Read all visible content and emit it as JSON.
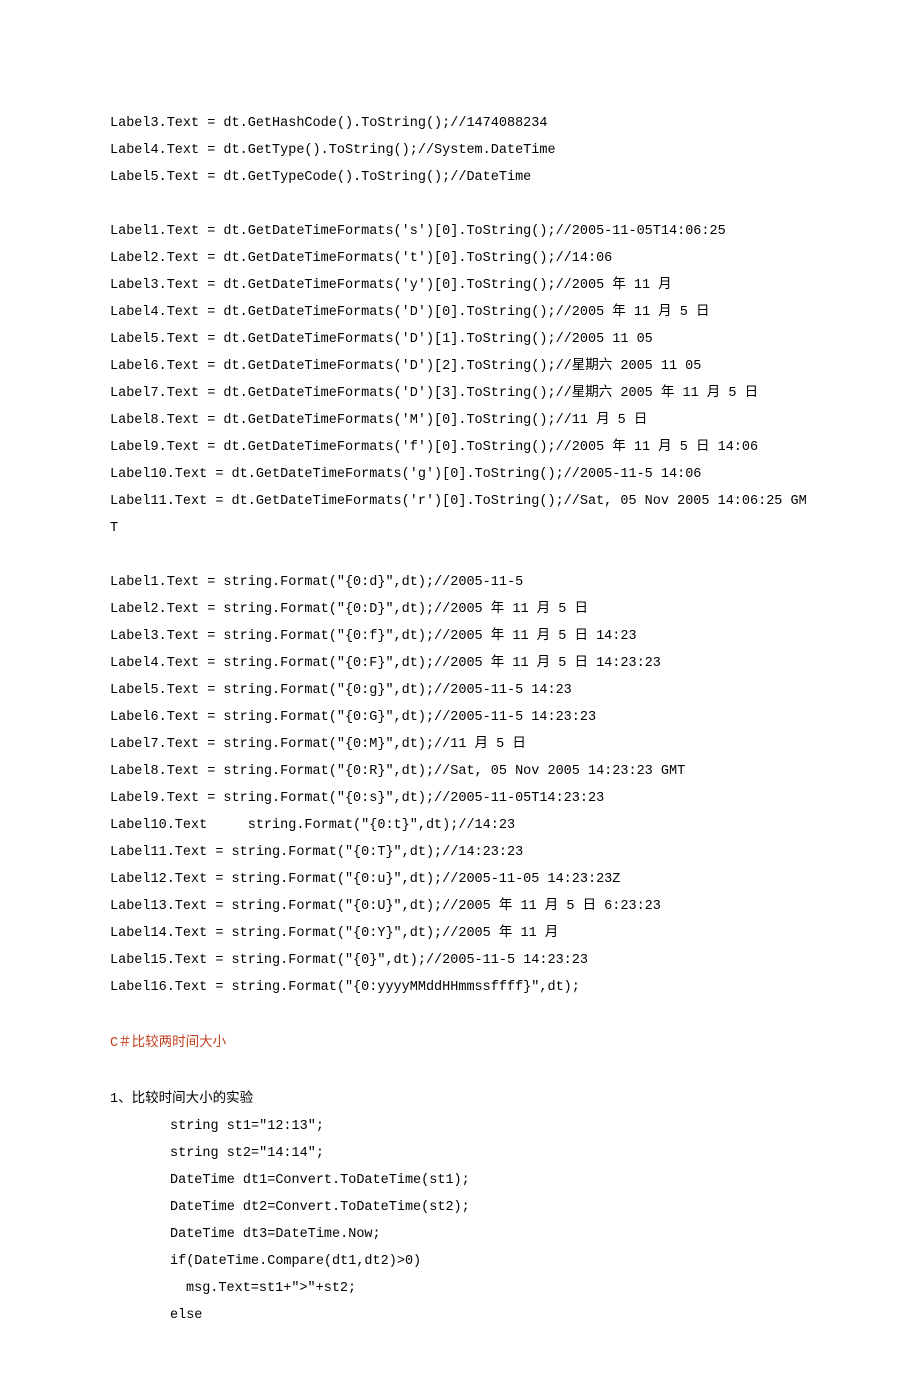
{
  "block1": [
    "Label3.Text = dt.GetHashCode().ToString();//1474088234",
    "Label4.Text = dt.GetType().ToString();//System.DateTime",
    "Label5.Text = dt.GetTypeCode().ToString();//DateTime"
  ],
  "block2": [
    "Label1.Text = dt.GetDateTimeFormats('s')[0].ToString();//2005-11-05T14:06:25",
    "Label2.Text = dt.GetDateTimeFormats('t')[0].ToString();//14:06",
    "Label3.Text = dt.GetDateTimeFormats('y')[0].ToString();//2005 年 11 月",
    "Label4.Text = dt.GetDateTimeFormats('D')[0].ToString();//2005 年 11 月 5 日",
    "Label5.Text = dt.GetDateTimeFormats('D')[1].ToString();//2005 11 05",
    "Label6.Text = dt.GetDateTimeFormats('D')[2].ToString();//星期六 2005 11 05",
    "Label7.Text = dt.GetDateTimeFormats('D')[3].ToString();//星期六 2005 年 11 月 5 日",
    "Label8.Text = dt.GetDateTimeFormats('M')[0].ToString();//11 月 5 日",
    "Label9.Text = dt.GetDateTimeFormats('f')[0].ToString();//2005 年 11 月 5 日 14:06",
    "Label10.Text = dt.GetDateTimeFormats('g')[0].ToString();//2005-11-5 14:06",
    "Label11.Text = dt.GetDateTimeFormats('r')[0].ToString();//Sat, 05 Nov 2005 14:06:25 GMT"
  ],
  "block3": [
    "Label1.Text = string.Format(\"{0:d}\",dt);//2005-11-5",
    "Label2.Text = string.Format(\"{0:D}\",dt);//2005 年 11 月 5 日",
    "Label3.Text = string.Format(\"{0:f}\",dt);//2005 年 11 月 5 日 14:23",
    "Label4.Text = string.Format(\"{0:F}\",dt);//2005 年 11 月 5 日 14:23:23",
    "Label5.Text = string.Format(\"{0:g}\",dt);//2005-11-5 14:23",
    "Label6.Text = string.Format(\"{0:G}\",dt);//2005-11-5 14:23:23",
    "Label7.Text = string.Format(\"{0:M}\",dt);//11 月 5 日",
    "Label8.Text = string.Format(\"{0:R}\",dt);//Sat, 05 Nov 2005 14:23:23 GMT",
    "Label9.Text = string.Format(\"{0:s}\",dt);//2005-11-05T14:23:23",
    "Label10.Text     string.Format(\"{0:t}\",dt);//14:23",
    "Label11.Text = string.Format(\"{0:T}\",dt);//14:23:23",
    "Label12.Text = string.Format(\"{0:u}\",dt);//2005-11-05 14:23:23Z",
    "Label13.Text = string.Format(\"{0:U}\",dt);//2005 年 11 月 5 日 6:23:23",
    "Label14.Text = string.Format(\"{0:Y}\",dt);//2005 年 11 月",
    "Label15.Text = string.Format(\"{0}\",dt);//2005-11-5 14:23:23",
    "Label16.Text = string.Format(\"{0:yyyyMMddHHmmssffff}\",dt);"
  ],
  "heading": "C＃比较两时间大小",
  "block4_intro": "1、比较时间大小的实验",
  "block4": [
    "string st1=\"12:13\";",
    "string st2=\"14:14\";",
    "DateTime dt1=Convert.ToDateTime(st1);",
    "DateTime dt2=Convert.ToDateTime(st2);",
    "DateTime dt3=DateTime.Now;",
    "if(DateTime.Compare(dt1,dt2)>0)"
  ],
  "block4_inner": "msg.Text=st1+\">\"+st2;",
  "block4_last": "else"
}
